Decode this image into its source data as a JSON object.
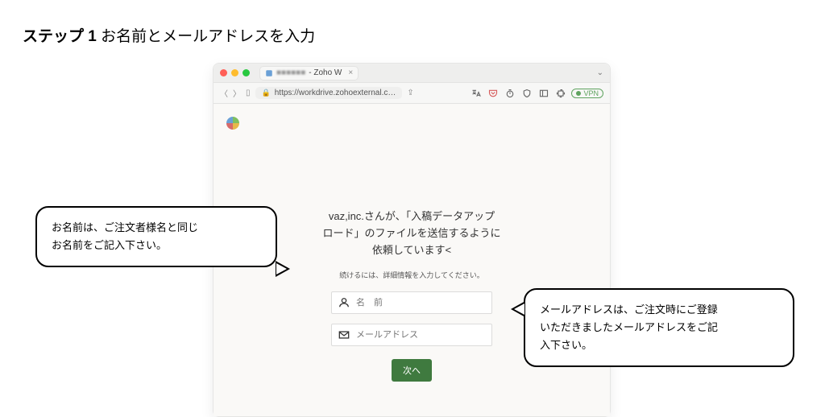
{
  "title": {
    "step": "ステップ 1",
    "rest": " お名前とメールアドレスを入力"
  },
  "browser": {
    "tab_title": " - Zoho W",
    "tab_prefix_blur": "■■■■■■",
    "url": "https://workdrive.zohoexternal.c…",
    "vpn_label": "VPN"
  },
  "form": {
    "request_line1": "vaz,inc.さんが、「入稿データアップ",
    "request_line2": "ロード」のファイルを送信するように",
    "request_line3": "依頼しています<",
    "continue_hint": "続けるには、詳細情報を入力してください。",
    "name_placeholder": "名　前",
    "email_placeholder": "メールアドレス",
    "next_label": "次へ"
  },
  "bubbles": {
    "left_line1": "お名前は、ご注文者様名と同じ",
    "left_line2": "お名前をご記入下さい。",
    "right_line1": "メールアドレスは、ご注文時にご登録",
    "right_line2": "いただきましたメールアドレスをご記",
    "right_line3": "入下さい。"
  }
}
